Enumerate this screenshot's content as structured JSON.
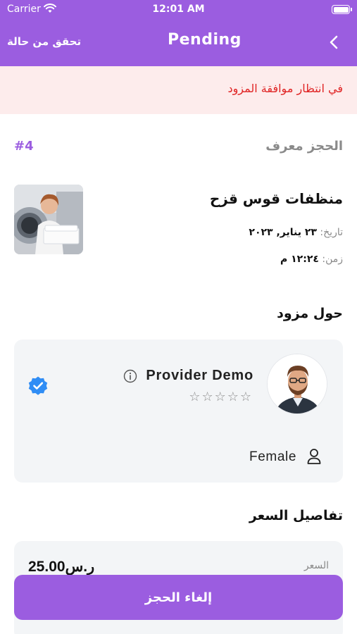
{
  "status_bar": {
    "carrier": "Carrier",
    "time": "12:01 AM"
  },
  "nav": {
    "title": "Pending",
    "check_status": "تحقق من حالة"
  },
  "alert": {
    "message": "في انتظار موافقة المزود"
  },
  "booking": {
    "id_label": "الحجز معرف",
    "id_value": "#4",
    "service_name": "منظفات قوس قزح",
    "date_label": "تاريخ:",
    "date_value": "٢٣ يناير, ٢٠٢٣",
    "time_label": "زمن:",
    "time_value": "١٢:٢٤ م"
  },
  "provider_section": {
    "title": "حول مزود",
    "name": "Provider Demo",
    "rating": 0,
    "stars": "☆☆☆☆☆",
    "gender": "Female"
  },
  "price_section": {
    "title": "تفاصيل السعر",
    "price_label": "السعر",
    "price_value": "ر.س25.00"
  },
  "actions": {
    "cancel_label": "إلغاء الحجز"
  },
  "colors": {
    "primary": "#9b5de0",
    "alert_bg": "#fdecec",
    "alert_text": "#e02424",
    "card_bg": "#f3f5f7",
    "verified": "#2f8df5"
  },
  "icons": {
    "back": "chevron-left-icon",
    "wifi": "wifi-icon",
    "battery": "battery-icon",
    "info": "info-icon",
    "verified": "verified-badge-icon",
    "person": "person-icon",
    "star": "star-outline-icon"
  }
}
